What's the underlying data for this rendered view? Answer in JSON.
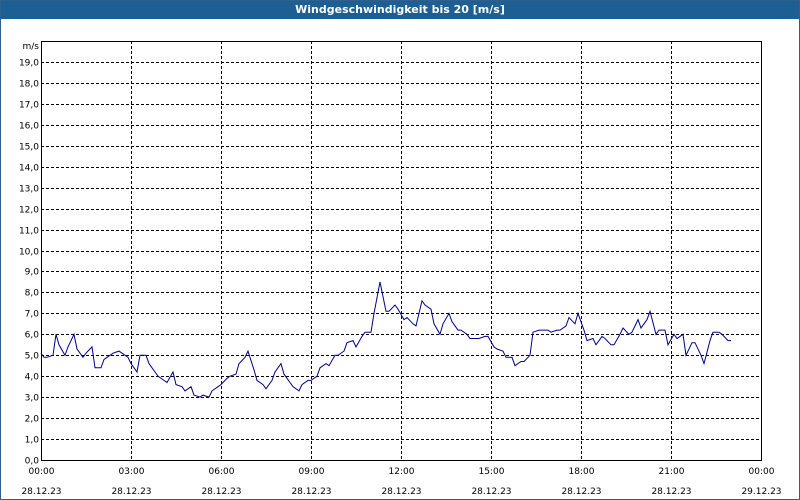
{
  "window": {
    "title": "Windgeschwindigkeit bis 20 [m/s]"
  },
  "chart_data": {
    "type": "line",
    "title": "Windgeschwindigkeit bis 20 [m/s]",
    "y_unit": "m/s",
    "ylim": [
      0,
      20
    ],
    "y_ticks": [
      "0,0",
      "1,0",
      "2,0",
      "3,0",
      "4,0",
      "5,0",
      "6,0",
      "7,0",
      "8,0",
      "9,0",
      "10,0",
      "11,0",
      "12,0",
      "13,0",
      "14,0",
      "15,0",
      "16,0",
      "17,0",
      "18,0",
      "19,0"
    ],
    "x_range_hours": [
      0,
      24
    ],
    "x_ticks": [
      {
        "time": "00:00",
        "date": "28.12.23"
      },
      {
        "time": "03:00",
        "date": "28.12.23"
      },
      {
        "time": "06:00",
        "date": "28.12.23"
      },
      {
        "time": "09:00",
        "date": "28.12.23"
      },
      {
        "time": "12:00",
        "date": "28.12.23"
      },
      {
        "time": "15:00",
        "date": "28.12.23"
      },
      {
        "time": "18:00",
        "date": "28.12.23"
      },
      {
        "time": "21:00",
        "date": "28.12.23"
      },
      {
        "time": "00:00",
        "date": "29.12.23"
      }
    ],
    "grid": true,
    "line_color": "#00008b",
    "series": [
      {
        "x_hours": [
          0.0,
          0.1,
          0.2,
          0.4,
          0.5,
          0.6,
          0.8,
          0.9,
          1.1,
          1.2,
          1.4,
          1.5,
          1.7,
          1.8,
          2.0,
          2.1,
          2.3,
          2.4,
          2.6,
          2.7,
          2.9,
          3.0,
          3.2,
          3.3,
          3.5,
          3.6,
          3.8,
          3.9,
          4.1,
          4.2,
          4.4,
          4.5,
          4.7,
          4.8,
          5.0,
          5.1,
          5.3,
          5.4,
          5.6,
          5.7,
          5.9,
          6.0,
          6.2,
          6.3,
          6.5,
          6.6,
          6.8,
          6.9,
          7.1,
          7.2,
          7.4,
          7.5,
          7.7,
          7.8,
          8.0,
          8.1,
          8.3,
          8.4,
          8.6,
          8.7,
          8.9,
          9.0,
          9.2,
          9.3,
          9.5,
          9.6,
          9.8,
          9.9,
          10.1,
          10.2,
          10.4,
          10.5,
          10.7,
          10.8,
          11.0,
          11.1,
          11.3,
          11.5,
          11.6,
          11.8,
          11.9,
          12.1,
          12.2,
          12.4,
          12.5,
          12.7,
          12.8,
          13.0,
          13.1,
          13.3,
          13.4,
          13.6,
          13.7,
          13.9,
          14.0,
          14.2,
          14.3,
          14.5,
          14.6,
          14.8,
          14.9,
          15.1,
          15.2,
          15.4,
          15.5,
          15.7,
          15.8,
          16.0,
          16.1,
          16.3,
          16.4,
          16.6,
          16.7,
          16.9,
          17.0,
          17.2,
          17.3,
          17.5,
          17.6,
          17.8,
          17.9,
          18.1,
          18.2,
          18.4,
          18.5,
          18.7,
          18.8,
          19.0,
          19.1,
          19.3,
          19.4,
          19.6,
          19.7,
          19.9,
          20.0,
          20.2,
          20.3,
          20.5,
          20.6,
          20.8,
          20.9,
          21.1,
          21.2,
          21.4,
          21.5,
          21.7,
          21.8,
          22.0,
          22.1,
          22.3,
          22.4,
          22.6,
          22.7,
          22.9,
          23.0,
          23.2,
          23.3,
          23.5,
          23.6,
          23.8,
          23.9
        ],
        "values": [
          5.1,
          4.9,
          4.9,
          5.0,
          6.0,
          5.5,
          5.0,
          5.4,
          6.0,
          5.3,
          4.9,
          5.1,
          5.4,
          4.4,
          4.4,
          4.8,
          5.0,
          5.1,
          5.2,
          5.1,
          4.9,
          4.6,
          4.2,
          5.0,
          5.0,
          4.6,
          4.2,
          4.0,
          3.8,
          3.7,
          4.2,
          3.6,
          3.5,
          3.3,
          3.5,
          3.1,
          3.0,
          3.1,
          3.0,
          3.3,
          3.5,
          3.6,
          3.9,
          4.0,
          4.1,
          4.6,
          4.9,
          5.2,
          4.3,
          3.8,
          3.6,
          3.4,
          3.8,
          4.2,
          4.6,
          4.1,
          3.7,
          3.5,
          3.3,
          3.6,
          3.8,
          3.8,
          4.0,
          4.4,
          4.6,
          4.5,
          5.0,
          5.0,
          5.2,
          5.6,
          5.7,
          5.4,
          5.9,
          6.1,
          6.1,
          7.0,
          8.5,
          7.1,
          7.1,
          7.4,
          7.2,
          6.7,
          6.8,
          6.5,
          6.4,
          7.6,
          7.4,
          7.2,
          6.5,
          6.0,
          6.5,
          7.0,
          6.6,
          6.2,
          6.2,
          6.0,
          5.8,
          5.8,
          5.8,
          5.9,
          5.9,
          5.4,
          5.3,
          5.2,
          4.9,
          4.9,
          4.5,
          4.7,
          4.7,
          5.0,
          6.1,
          6.2,
          6.2,
          6.2,
          6.1,
          6.2,
          6.2,
          6.4,
          6.8,
          6.5,
          7.0,
          6.2,
          5.7,
          5.8,
          5.5,
          5.9,
          5.8,
          5.5,
          5.5,
          6.0,
          6.3,
          6.0,
          6.1,
          6.7,
          6.3,
          6.7,
          7.1,
          6.0,
          6.2,
          6.2,
          5.5,
          6.0,
          5.8,
          6.0,
          5.0,
          5.6,
          5.6,
          5.0,
          4.6,
          5.7,
          6.1,
          6.1,
          6.0,
          5.7,
          5.7
        ]
      }
    ]
  }
}
